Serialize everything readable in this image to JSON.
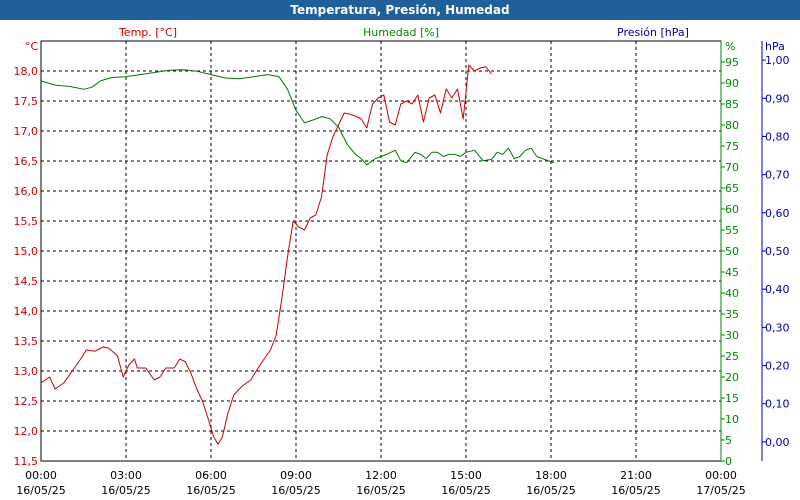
{
  "chart_data": {
    "type": "line",
    "title": "Temperatura, Presión, Humedad",
    "axes": {
      "temp": {
        "label": "Temp. [°C]",
        "unit": "°C",
        "min": 11.5,
        "max": 18.5,
        "ticks": [
          "11,5",
          "12,0",
          "12,5",
          "13,0",
          "13,5",
          "14,0",
          "14,5",
          "15,0",
          "15,5",
          "16,0",
          "16,5",
          "17,0",
          "17,5",
          "18,0"
        ]
      },
      "humidity": {
        "label": "Humedad [%]",
        "unit": "%",
        "min": 0,
        "max": 100,
        "ticks": [
          "0",
          "5",
          "10",
          "15",
          "20",
          "25",
          "30",
          "35",
          "40",
          "45",
          "50",
          "55",
          "60",
          "65",
          "70",
          "75",
          "80",
          "85",
          "90",
          "95"
        ]
      },
      "pressure": {
        "label": "Presión [hPa]",
        "unit": "hPa",
        "min": -0.05,
        "max": 1.05,
        "ticks": [
          "0,00",
          "0,10",
          "0,20",
          "0,30",
          "0,40",
          "0,50",
          "0,60",
          "0,70",
          "0,80",
          "0,90",
          "1,00"
        ]
      }
    },
    "x_ticks": [
      {
        "time": "00:00",
        "date": "16/05/25"
      },
      {
        "time": "03:00",
        "date": "16/05/25"
      },
      {
        "time": "06:00",
        "date": "16/05/25"
      },
      {
        "time": "09:00",
        "date": "16/05/25"
      },
      {
        "time": "12:00",
        "date": "16/05/25"
      },
      {
        "time": "15:00",
        "date": "16/05/25"
      },
      {
        "time": "18:00",
        "date": "16/05/25"
      },
      {
        "time": "21:00",
        "date": "16/05/25"
      },
      {
        "time": "00:00",
        "date": "17/05/25"
      }
    ],
    "x_range_hours": [
      0,
      24
    ],
    "grid": true,
    "series": [
      {
        "name": "Temp. [°C]",
        "axis": "temp",
        "color": "#cc0000",
        "points": [
          [
            0,
            12.8
          ],
          [
            0.3,
            12.9
          ],
          [
            0.5,
            12.7
          ],
          [
            0.8,
            12.8
          ],
          [
            1.1,
            13.0
          ],
          [
            1.4,
            13.2
          ],
          [
            1.6,
            13.35
          ],
          [
            1.9,
            13.33
          ],
          [
            2.2,
            13.4
          ],
          [
            2.4,
            13.38
          ],
          [
            2.7,
            13.25
          ],
          [
            2.9,
            12.9
          ],
          [
            3.1,
            13.1
          ],
          [
            3.3,
            13.2
          ],
          [
            3.4,
            13.05
          ],
          [
            3.7,
            13.05
          ],
          [
            4.0,
            12.85
          ],
          [
            4.2,
            12.9
          ],
          [
            4.4,
            13.05
          ],
          [
            4.7,
            13.05
          ],
          [
            4.9,
            13.2
          ],
          [
            5.1,
            13.15
          ],
          [
            5.3,
            12.95
          ],
          [
            5.5,
            12.7
          ],
          [
            5.7,
            12.5
          ],
          [
            5.9,
            12.2
          ],
          [
            6.1,
            11.9
          ],
          [
            6.25,
            11.78
          ],
          [
            6.4,
            11.9
          ],
          [
            6.6,
            12.3
          ],
          [
            6.8,
            12.6
          ],
          [
            7.1,
            12.75
          ],
          [
            7.4,
            12.85
          ],
          [
            7.6,
            13.0
          ],
          [
            7.8,
            13.15
          ],
          [
            8.1,
            13.35
          ],
          [
            8.3,
            13.6
          ],
          [
            8.5,
            14.2
          ],
          [
            8.7,
            14.9
          ],
          [
            8.9,
            15.5
          ],
          [
            9.1,
            15.4
          ],
          [
            9.3,
            15.35
          ],
          [
            9.5,
            15.55
          ],
          [
            9.7,
            15.6
          ],
          [
            9.9,
            15.9
          ],
          [
            10.1,
            16.6
          ],
          [
            10.3,
            16.9
          ],
          [
            10.5,
            17.1
          ],
          [
            10.7,
            17.3
          ],
          [
            10.9,
            17.28
          ],
          [
            11.1,
            17.25
          ],
          [
            11.3,
            17.2
          ],
          [
            11.5,
            17.05
          ],
          [
            11.7,
            17.45
          ],
          [
            11.9,
            17.55
          ],
          [
            12.1,
            17.6
          ],
          [
            12.3,
            17.15
          ],
          [
            12.5,
            17.1
          ],
          [
            12.7,
            17.45
          ],
          [
            12.9,
            17.5
          ],
          [
            13.1,
            17.45
          ],
          [
            13.3,
            17.6
          ],
          [
            13.5,
            17.15
          ],
          [
            13.7,
            17.55
          ],
          [
            13.9,
            17.6
          ],
          [
            14.1,
            17.3
          ],
          [
            14.3,
            17.7
          ],
          [
            14.5,
            17.55
          ],
          [
            14.7,
            17.7
          ],
          [
            14.9,
            17.2
          ],
          [
            15.1,
            18.1
          ],
          [
            15.3,
            18.0
          ],
          [
            15.5,
            18.05
          ],
          [
            15.7,
            18.07
          ],
          [
            15.9,
            17.95
          ]
        ]
      },
      {
        "name": "Humedad [%]",
        "axis": "humidity",
        "color": "#007700",
        "points": [
          [
            0,
            90.5
          ],
          [
            0.5,
            89.5
          ],
          [
            1.0,
            89.2
          ],
          [
            1.3,
            88.8
          ],
          [
            1.5,
            88.5
          ],
          [
            1.8,
            89.0
          ],
          [
            2.1,
            90.5
          ],
          [
            2.5,
            91.3
          ],
          [
            3.0,
            91.5
          ],
          [
            3.5,
            92.0
          ],
          [
            4.0,
            92.5
          ],
          [
            4.5,
            93.0
          ],
          [
            5.0,
            93.2
          ],
          [
            5.5,
            92.8
          ],
          [
            6.0,
            92.0
          ],
          [
            6.5,
            91.2
          ],
          [
            7.0,
            91.0
          ],
          [
            7.5,
            91.5
          ],
          [
            8.0,
            92.0
          ],
          [
            8.4,
            91.5
          ],
          [
            8.7,
            88.5
          ],
          [
            9.0,
            83.5
          ],
          [
            9.3,
            80.5
          ],
          [
            9.6,
            81.2
          ],
          [
            9.9,
            82.0
          ],
          [
            10.2,
            81.5
          ],
          [
            10.5,
            79.5
          ],
          [
            10.8,
            75.5
          ],
          [
            11.1,
            73.0
          ],
          [
            11.3,
            72.0
          ],
          [
            11.5,
            70.5
          ],
          [
            11.8,
            72.0
          ],
          [
            12.0,
            72.5
          ],
          [
            12.2,
            73.0
          ],
          [
            12.5,
            74.0
          ],
          [
            12.7,
            71.5
          ],
          [
            12.9,
            71.0
          ],
          [
            13.2,
            73.5
          ],
          [
            13.4,
            73.0
          ],
          [
            13.6,
            72.0
          ],
          [
            13.8,
            73.5
          ],
          [
            14.0,
            73.5
          ],
          [
            14.2,
            72.5
          ],
          [
            14.4,
            73.0
          ],
          [
            14.6,
            73.0
          ],
          [
            14.8,
            72.5
          ],
          [
            15.0,
            73.5
          ],
          [
            15.3,
            74.0
          ],
          [
            15.6,
            71.5
          ],
          [
            15.9,
            71.8
          ],
          [
            16.1,
            73.5
          ],
          [
            16.3,
            73.0
          ],
          [
            16.5,
            74.5
          ],
          [
            16.7,
            72.0
          ],
          [
            16.9,
            72.5
          ],
          [
            17.1,
            74.0
          ],
          [
            17.3,
            74.5
          ],
          [
            17.5,
            72.5
          ],
          [
            17.7,
            72.0
          ],
          [
            17.9,
            71.5
          ],
          [
            18.1,
            71.0
          ]
        ]
      }
    ]
  }
}
